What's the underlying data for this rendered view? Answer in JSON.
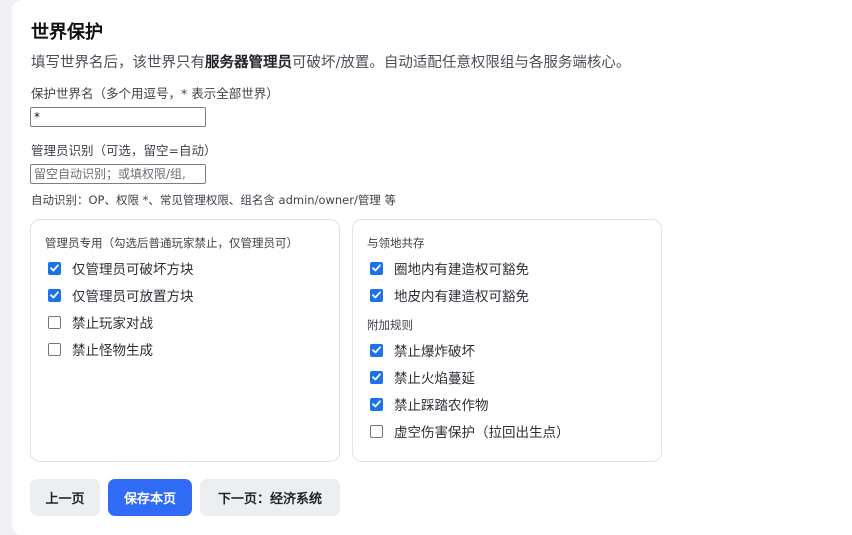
{
  "page": {
    "title": "世界保护",
    "description_prefix": "填写世界名后，该世界只有",
    "description_bold": "服务器管理员",
    "description_suffix": "可破坏/放置。自动适配任意权限组与各服务端核心。"
  },
  "world_field": {
    "label": "保护世界名（多个用逗号，* 表示全部世界）",
    "value": "*"
  },
  "admin_field": {
    "label": "管理员识别（可选，留空=自动）",
    "value": "",
    "placeholder": "留空自动识别；或填权限/组,"
  },
  "hint": "自动识别：OP、权限 *、常见管理权限、组名含 admin/owner/管理 等",
  "left_card": {
    "section_title": "管理员专用（勾选后普通玩家禁止，仅管理员可）",
    "options": [
      {
        "label": "仅管理员可破坏方块",
        "checked": true
      },
      {
        "label": "仅管理员可放置方块",
        "checked": true
      },
      {
        "label": "禁止玩家对战",
        "checked": false
      },
      {
        "label": "禁止怪物生成",
        "checked": false
      }
    ]
  },
  "right_card": {
    "section1_title": "与领地共存",
    "section1_options": [
      {
        "label": "圈地内有建造权可豁免",
        "checked": true
      },
      {
        "label": "地皮内有建造权可豁免",
        "checked": true
      }
    ],
    "section2_title": "附加规则",
    "section2_options": [
      {
        "label": "禁止爆炸破坏",
        "checked": true
      },
      {
        "label": "禁止火焰蔓延",
        "checked": true
      },
      {
        "label": "禁止踩踏农作物",
        "checked": true
      },
      {
        "label": "虚空伤害保护（拉回出生点）",
        "checked": false
      }
    ]
  },
  "buttons": {
    "prev": "上一页",
    "save": "保存本页",
    "next": "下一页：经济系统"
  },
  "colors": {
    "accent": "#2f6bf5",
    "checkbox": "#1a73e8",
    "secondary_button": "#eceef1"
  }
}
